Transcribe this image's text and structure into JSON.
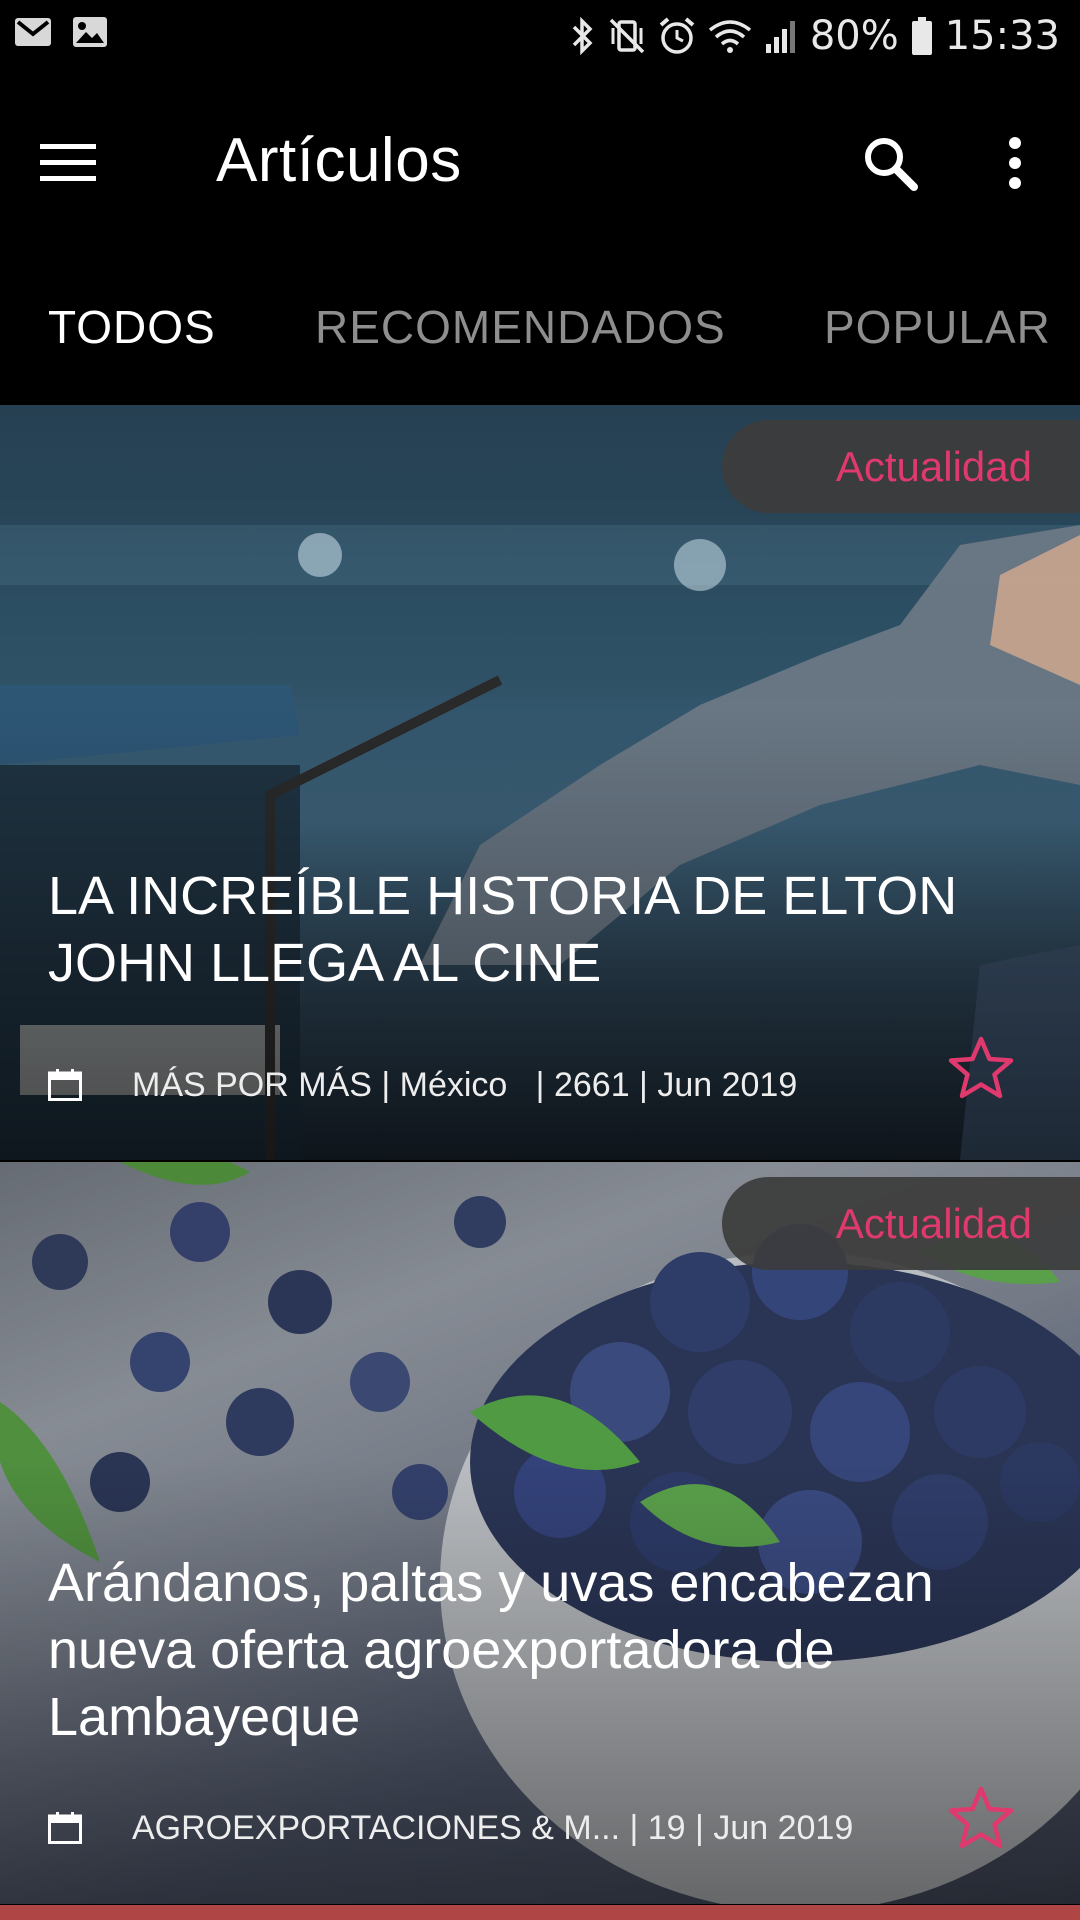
{
  "status_bar": {
    "notification_icons": [
      "gmail-icon",
      "gallery-icon"
    ],
    "system_icons": [
      "bluetooth-icon",
      "vibrate-icon",
      "alarm-icon",
      "wifi-icon",
      "signal-icon"
    ],
    "battery": "80%",
    "time": "15:33"
  },
  "app_bar": {
    "title": "Artículos",
    "menu_icon": "menu-icon",
    "search_icon": "search-icon",
    "more_icon": "more-vert-icon"
  },
  "tabs": [
    {
      "label": "TODOS",
      "active": true
    },
    {
      "label": "RECOMENDADOS",
      "active": false
    },
    {
      "label": "POPULAR",
      "active": false
    }
  ],
  "articles": [
    {
      "category": "Actualidad",
      "title": "LA INCREÍBLE HISTORIA DE ELTON JOHN LLEGA AL CINE",
      "meta": "MÁS POR MÁS | México   | 2661 | Jun 2019"
    },
    {
      "category": "Actualidad",
      "title": "Arándanos, paltas y uvas encabezan nueva oferta agroexportadora de Lambayeque",
      "meta": "AGROEXPORTACIONES & M... | 19 | Jun 2019"
    }
  ],
  "colors": {
    "accent": "#e0396e",
    "background": "#000000",
    "tab_active": "#ffffff",
    "tab_inactive": "#8e8e8e"
  }
}
